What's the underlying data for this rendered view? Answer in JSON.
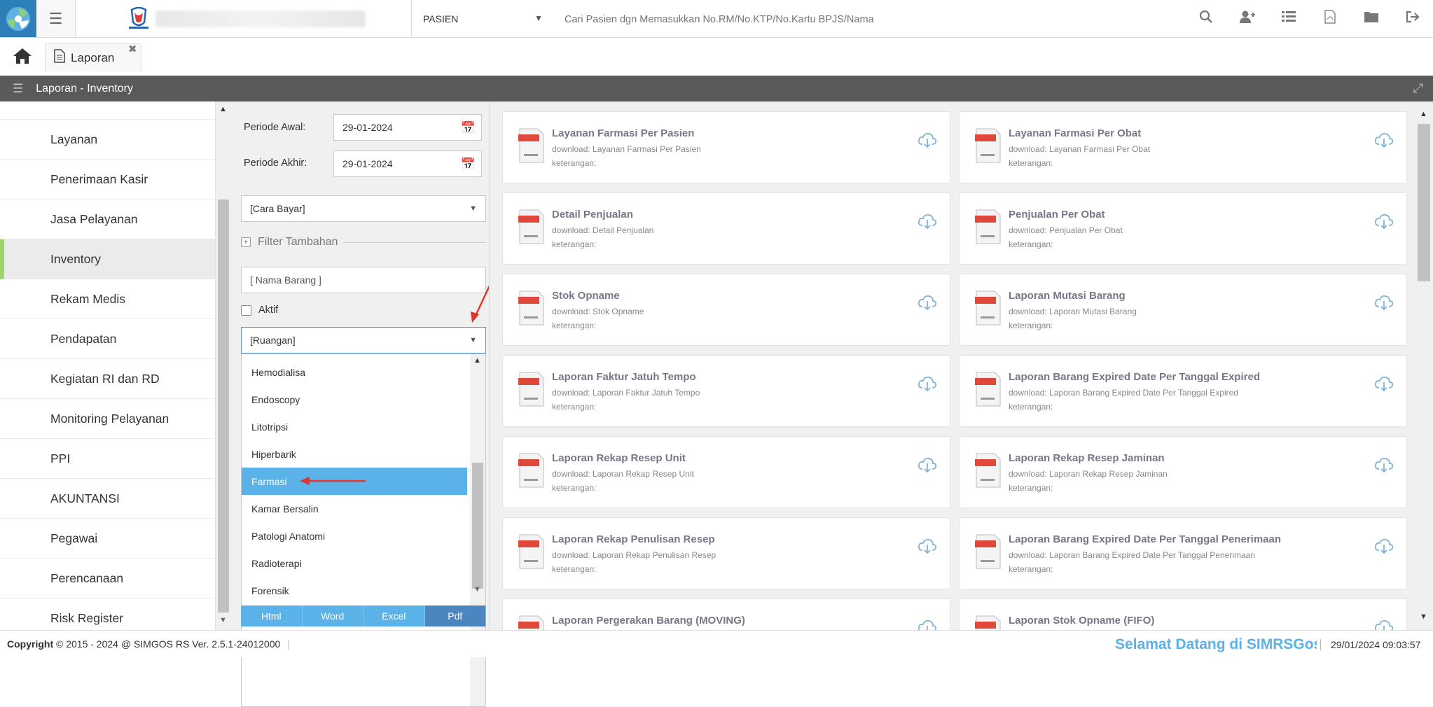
{
  "topbar": {
    "patient_type": "PASIEN",
    "search_placeholder": "Cari Pasien dgn Memasukkan No.RM/No.KTP/No.Kartu BPJS/Nama",
    "icons": [
      "search-icon",
      "add-user-icon",
      "list-icon",
      "pdf-icon",
      "folder-icon",
      "logout-icon"
    ]
  },
  "tabs": [
    {
      "label": "Laporan"
    }
  ],
  "header": {
    "title": "Laporan - Inventory"
  },
  "sidebar": {
    "items": [
      {
        "label": "Layanan"
      },
      {
        "label": "Penerimaan Kasir"
      },
      {
        "label": "Jasa Pelayanan"
      },
      {
        "label": "Inventory"
      },
      {
        "label": "Rekam Medis"
      },
      {
        "label": "Pendapatan"
      },
      {
        "label": "Kegiatan RI dan RD"
      },
      {
        "label": "Monitoring Pelayanan"
      },
      {
        "label": "PPI"
      },
      {
        "label": "AKUNTANSI"
      },
      {
        "label": "Pegawai"
      },
      {
        "label": "Perencanaan"
      },
      {
        "label": "Risk Register"
      }
    ],
    "active": "Inventory"
  },
  "filters": {
    "periode_awal_label": "Periode Awal:",
    "periode_awal_value": "29-01-2024",
    "periode_akhir_label": "Periode Akhir:",
    "periode_akhir_value": "29-01-2024",
    "cara_bayar": "[Cara Bayar]",
    "filter_tambahan": "Filter Tambahan",
    "nama_barang_placeholder": "[ Nama Barang ]",
    "aktif_label": "Aktif",
    "ruangan_value": "[Ruangan]",
    "ruangan_options": [
      "Hemodialisa",
      "Endoscopy",
      "Litotripsi",
      "Hiperbarik",
      "Farmasi",
      "Kamar Bersalin",
      "Patologi Anatomi",
      "Radioterapi",
      "Forensik"
    ],
    "selected_option": "Farmasi",
    "export": {
      "html": "Html",
      "word": "Word",
      "excel": "Excel",
      "pdf": "Pdf"
    }
  },
  "reports": [
    {
      "title": "Layanan Farmasi Per Pasien",
      "download": "download: Layanan Farmasi Per Pasien",
      "ket": "keterangan:"
    },
    {
      "title": "Layanan Farmasi Per Obat",
      "download": "download: Layanan Farmasi Per Obat",
      "ket": "keterangan:"
    },
    {
      "title": "Detail Penjualan",
      "download": "download: Detail Penjualan",
      "ket": "keterangan:"
    },
    {
      "title": "Penjualan Per Obat",
      "download": "download: Penjualan Per Obat",
      "ket": "keterangan:"
    },
    {
      "title": "Stok Opname",
      "download": "download: Stok Opname",
      "ket": "keterangan:"
    },
    {
      "title": "Laporan Mutasi Barang",
      "download": "download: Laporan Mutasi Barang",
      "ket": "keterangan:"
    },
    {
      "title": "Laporan Faktur Jatuh Tempo",
      "download": "download: Laporan Faktur Jatuh Tempo",
      "ket": "keterangan:"
    },
    {
      "title": "Laporan Barang Expired Date Per Tanggal Expired",
      "download": "download: Laporan Barang Expired Date Per Tanggal Expired",
      "ket": "keterangan:"
    },
    {
      "title": "Laporan Rekap Resep Unit",
      "download": "download: Laporan Rekap Resep Unit",
      "ket": "keterangan:"
    },
    {
      "title": "Laporan Rekap Resep Jaminan",
      "download": "download: Laporan Rekap Resep Jaminan",
      "ket": "keterangan:"
    },
    {
      "title": "Laporan Rekap Penulisan Resep",
      "download": "download: Laporan Rekap Penulisan Resep",
      "ket": "keterangan:"
    },
    {
      "title": "Laporan Barang Expired Date Per Tanggal Penerimaan",
      "download": "download: Laporan Barang Expired Date Per Tanggal Penerimaan",
      "ket": "keterangan:"
    },
    {
      "title": "Laporan Pergerakan Barang (MOVING)",
      "download": "",
      "ket": ""
    },
    {
      "title": "Laporan Stok Opname (FIFO)",
      "download": "",
      "ket": ""
    }
  ],
  "footer": {
    "copyright_label": "Copyright",
    "copyright_text": "2015 - 2024 @ SIMGOS RS Ver. 2.5.1-24012000",
    "welcome": "Selamat Datang di SIMRSGos",
    "datetime": "29/01/2024 09:03:57"
  }
}
